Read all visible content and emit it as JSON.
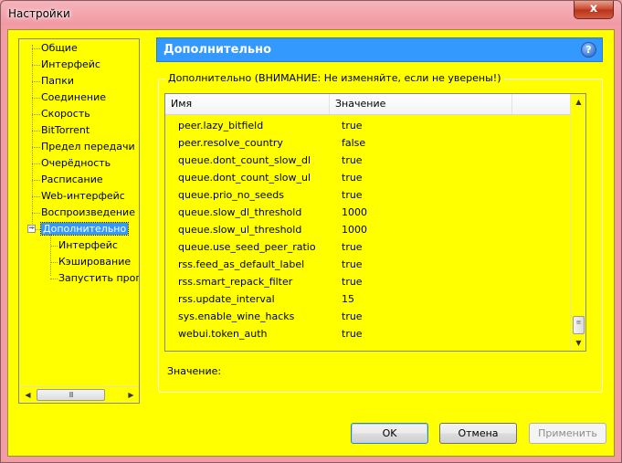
{
  "window": {
    "title": "Настройки",
    "close_glyph": "x"
  },
  "tree": {
    "items": [
      {
        "label": "Общие"
      },
      {
        "label": "Интерфейс"
      },
      {
        "label": "Папки"
      },
      {
        "label": "Соединение"
      },
      {
        "label": "Скорость"
      },
      {
        "label": "BitTorrent"
      },
      {
        "label": "Предел передачи"
      },
      {
        "label": "Очерёдность"
      },
      {
        "label": "Расписание"
      },
      {
        "label": "Web-интерфейс"
      },
      {
        "label": "Воспроизведение"
      },
      {
        "label": "Дополнительно",
        "selected": true,
        "expanded": true
      },
      {
        "label": "Интерфейс",
        "child": true
      },
      {
        "label": "Кэширование",
        "child": true
      },
      {
        "label": "Запустить прогр",
        "child": true
      }
    ],
    "expander_glyph": "−",
    "scroll_left": "◀",
    "scroll_right": "▶",
    "thumb_grip": "III"
  },
  "panel": {
    "title": "Дополнительно",
    "help_glyph": "?",
    "group_title": "Дополнительно (ВНИМАНИЕ: Не изменяйте, если не уверены!)",
    "columns": {
      "name": "Имя",
      "value": "Значение"
    },
    "rows": [
      {
        "name": "peer.lazy_bitfield",
        "value": "true"
      },
      {
        "name": "peer.resolve_country",
        "value": "false"
      },
      {
        "name": "queue.dont_count_slow_dl",
        "value": "true"
      },
      {
        "name": "queue.dont_count_slow_ul",
        "value": "true"
      },
      {
        "name": "queue.prio_no_seeds",
        "value": "true"
      },
      {
        "name": "queue.slow_dl_threshold",
        "value": "1000"
      },
      {
        "name": "queue.slow_ul_threshold",
        "value": "1000"
      },
      {
        "name": "queue.use_seed_peer_ratio",
        "value": "true"
      },
      {
        "name": "rss.feed_as_default_label",
        "value": "true"
      },
      {
        "name": "rss.smart_repack_filter",
        "value": "true"
      },
      {
        "name": "rss.update_interval",
        "value": "15"
      },
      {
        "name": "sys.enable_wine_hacks",
        "value": "true"
      },
      {
        "name": "webui.token_auth",
        "value": "true"
      }
    ],
    "scroll_up": "▲",
    "scroll_down": "▼",
    "value_label": "Значение:"
  },
  "buttons": {
    "ok": "OK",
    "cancel": "Отмена",
    "apply": "Применить"
  }
}
